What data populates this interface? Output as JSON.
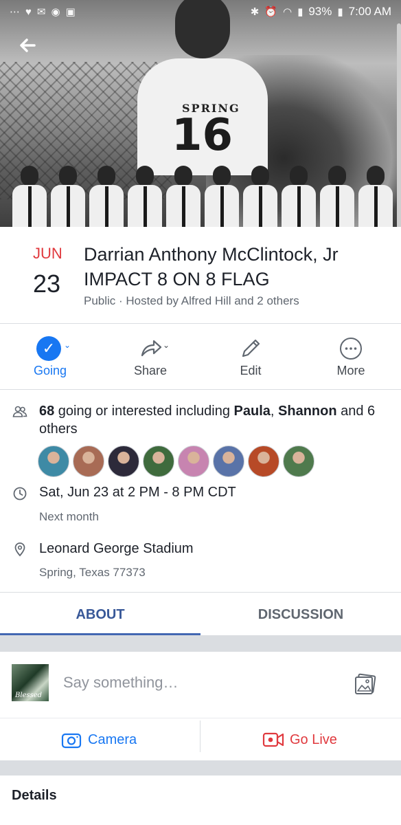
{
  "status_bar": {
    "battery": "93%",
    "time": "7:00 AM"
  },
  "cover": {
    "jersey_text": "SPRING",
    "jersey_number": "16"
  },
  "event": {
    "month": "JUN",
    "day": "23",
    "title": "Darrian Anthony McClintock, Jr IMPACT 8 ON 8 FLAG",
    "subtitle": "Public · Hosted by Alfred Hill and 2 others"
  },
  "actions": [
    {
      "label": "Going",
      "icon": "check-circle-icon"
    },
    {
      "label": "Share",
      "icon": "share-icon"
    },
    {
      "label": "Edit",
      "icon": "pencil-icon"
    },
    {
      "label": "More",
      "icon": "more-icon"
    }
  ],
  "guests": {
    "count": "68",
    "text_before": " going or interested including ",
    "name1": "Paula",
    "sep": ", ",
    "name2": "Shannon",
    "text_after": " and 6 others",
    "avatar_colors": [
      "#3e8aa5",
      "#a86b55",
      "#2d2a3a",
      "#3f6b3d",
      "#c784b0",
      "#5973a8",
      "#b74a27",
      "#4f7a4d"
    ]
  },
  "time": {
    "main": "Sat, Jun 23 at 2 PM - 8 PM CDT",
    "relative": "Next month"
  },
  "location": {
    "name": "Leonard George Stadium",
    "address": "Spring, Texas 77373"
  },
  "tabs": [
    {
      "label": "ABOUT",
      "active": true
    },
    {
      "label": "DISCUSSION",
      "active": false
    }
  ],
  "composer": {
    "placeholder": "Say something…",
    "avatar_caption": "Blessed"
  },
  "media": {
    "camera_label": "Camera",
    "golive_label": "Go Live"
  },
  "details": {
    "heading": "Details"
  },
  "colors": {
    "accent": "#1877f2",
    "date_red": "#e0393e",
    "live_red": "#e0393e",
    "tab_active": "#385898"
  }
}
